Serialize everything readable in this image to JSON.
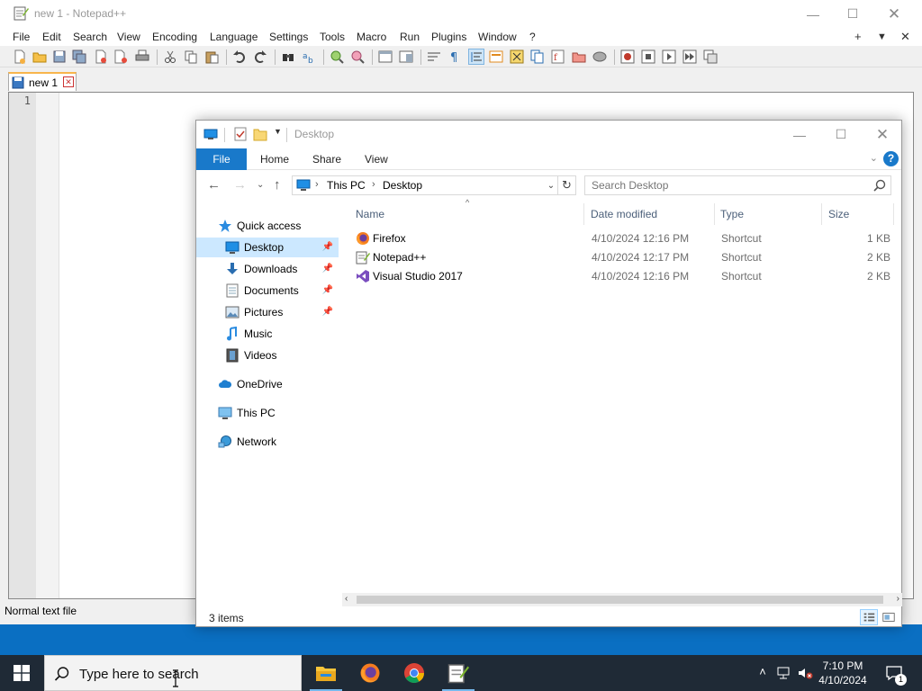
{
  "notepad": {
    "title": "new 1 - Notepad++",
    "menu": [
      "File",
      "Edit",
      "Search",
      "View",
      "Encoding",
      "Language",
      "Settings",
      "Tools",
      "Macro",
      "Run",
      "Plugins",
      "Window",
      "?"
    ],
    "menu_right": [
      "+",
      "▼",
      "✕"
    ],
    "tab_label": "new 1",
    "line_number": "1",
    "status": "Normal text file"
  },
  "explorer": {
    "title": "Desktop",
    "ribbon_tabs": [
      "File",
      "Home",
      "Share",
      "View"
    ],
    "help": "?",
    "breadcrumb": [
      "This PC",
      "Desktop"
    ],
    "search_placeholder": "Search Desktop",
    "nav": {
      "quick_access": "Quick access",
      "desktop": "Desktop",
      "downloads": "Downloads",
      "documents": "Documents",
      "pictures": "Pictures",
      "music": "Music",
      "videos": "Videos",
      "onedrive": "OneDrive",
      "this_pc": "This PC",
      "network": "Network"
    },
    "columns": {
      "name": "Name",
      "date": "Date modified",
      "type": "Type",
      "size": "Size"
    },
    "files": [
      {
        "name": "Firefox",
        "date": "4/10/2024 12:16 PM",
        "type": "Shortcut",
        "size": "1 KB",
        "icon": "firefox-icon"
      },
      {
        "name": "Notepad++",
        "date": "4/10/2024 12:17 PM",
        "type": "Shortcut",
        "size": "2 KB",
        "icon": "notepadpp-icon"
      },
      {
        "name": "Visual Studio 2017",
        "date": "4/10/2024 12:16 PM",
        "type": "Shortcut",
        "size": "2 KB",
        "icon": "visual-studio-icon"
      }
    ],
    "status": "3 items"
  },
  "taskbar": {
    "search_placeholder": "Type here to search",
    "time": "7:10 PM",
    "date": "4/10/2024",
    "notification_count": "1"
  },
  "colors": {
    "accent": "#1979ca",
    "selection": "#cce8ff",
    "taskbar": "#1f2a36",
    "desktop": "#0a6fc2"
  }
}
